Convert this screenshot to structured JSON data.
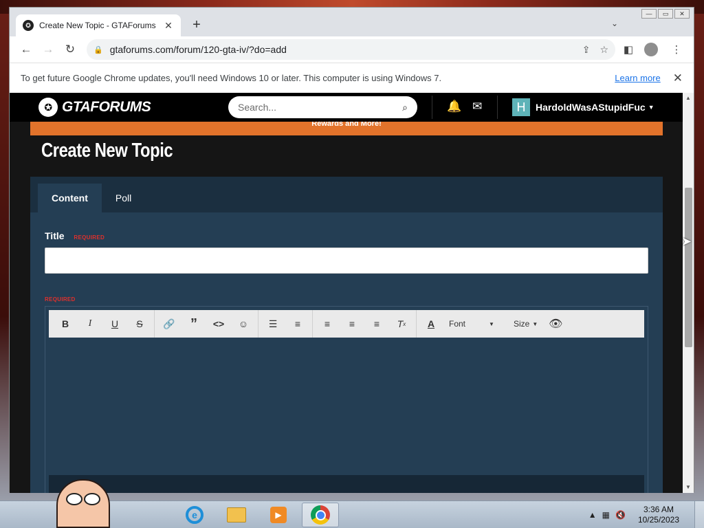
{
  "browser": {
    "tab_title": "Create New Topic - GTAForums",
    "url": "gtaforums.com/forum/120-gta-iv/?do=add",
    "new_tab_label": "+",
    "infobar": {
      "message": "To get future Google Chrome updates, you'll need Windows 10 or later. This computer is using Windows 7.",
      "learn_more": "Learn more"
    }
  },
  "site": {
    "logo_text": "GTAFORUMS",
    "search_placeholder": "Search...",
    "username": "HardoldWasAStupidFuc",
    "avatar_letter": "H",
    "promo_text": "Rewards and More!"
  },
  "page": {
    "title": "Create New Topic",
    "tabs": [
      {
        "label": "Content",
        "active": true
      },
      {
        "label": "Poll",
        "active": false
      }
    ],
    "title_label": "Title",
    "required_label": "REQUIRED",
    "editor": {
      "font_label": "Font",
      "size_label": "Size"
    }
  },
  "taskbar": {
    "time": "3:36 AM",
    "date": "10/25/2023"
  },
  "colors": {
    "accent_orange": "#e2732b",
    "panel_bg": "#243e54",
    "required_red": "#e0302c"
  }
}
